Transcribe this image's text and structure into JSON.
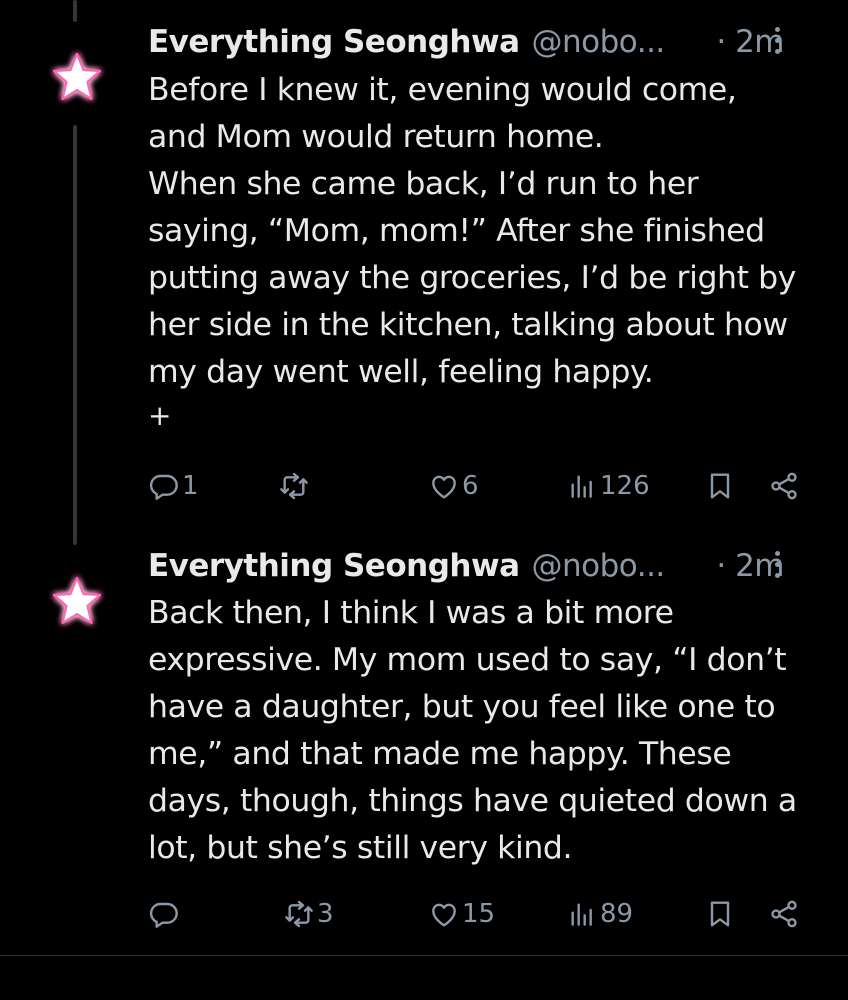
{
  "tweets": [
    {
      "author_name": "Everything Seonghwa",
      "author_handle": "@nobo...",
      "time": "· 2m",
      "text_lines": [
        "Before I knew it, evening would come,",
        "and Mom would return home.",
        "When she came back, I’d run to her",
        "saying, “Mom, mom!” After she finished",
        "putting away the groceries, I’d be right by",
        "her side in the kitchen, talking about how",
        "my day went well, feeling happy."
      ],
      "continuation": "+",
      "replies": "1",
      "reposts": "",
      "likes": "6",
      "views": "126"
    },
    {
      "author_name": "Everything Seonghwa",
      "author_handle": "@nobo...",
      "time": "· 2m",
      "text_lines": [
        "Back then, I think I was a bit more",
        "expressive. My mom used to say, “I don’t",
        "have a daughter, but you feel like one to",
        "me,” and that made me happy. These",
        "days, though, things have quieted down a",
        "lot, but she’s still very kind."
      ],
      "replies": "",
      "reposts": "3",
      "likes": "15",
      "views": "89"
    }
  ],
  "icons": {
    "avatar": "pink-glow-star-icon",
    "reply": "reply-icon",
    "repost": "repost-icon",
    "like": "like-icon",
    "views": "views-icon",
    "bookmark": "bookmark-icon",
    "share": "share-icon",
    "more": "more-options-icon"
  },
  "colors": {
    "background": "#000000",
    "text": "#e7e9ea",
    "muted": "#8b98a5",
    "avatar_glow": "#ff66b3"
  }
}
